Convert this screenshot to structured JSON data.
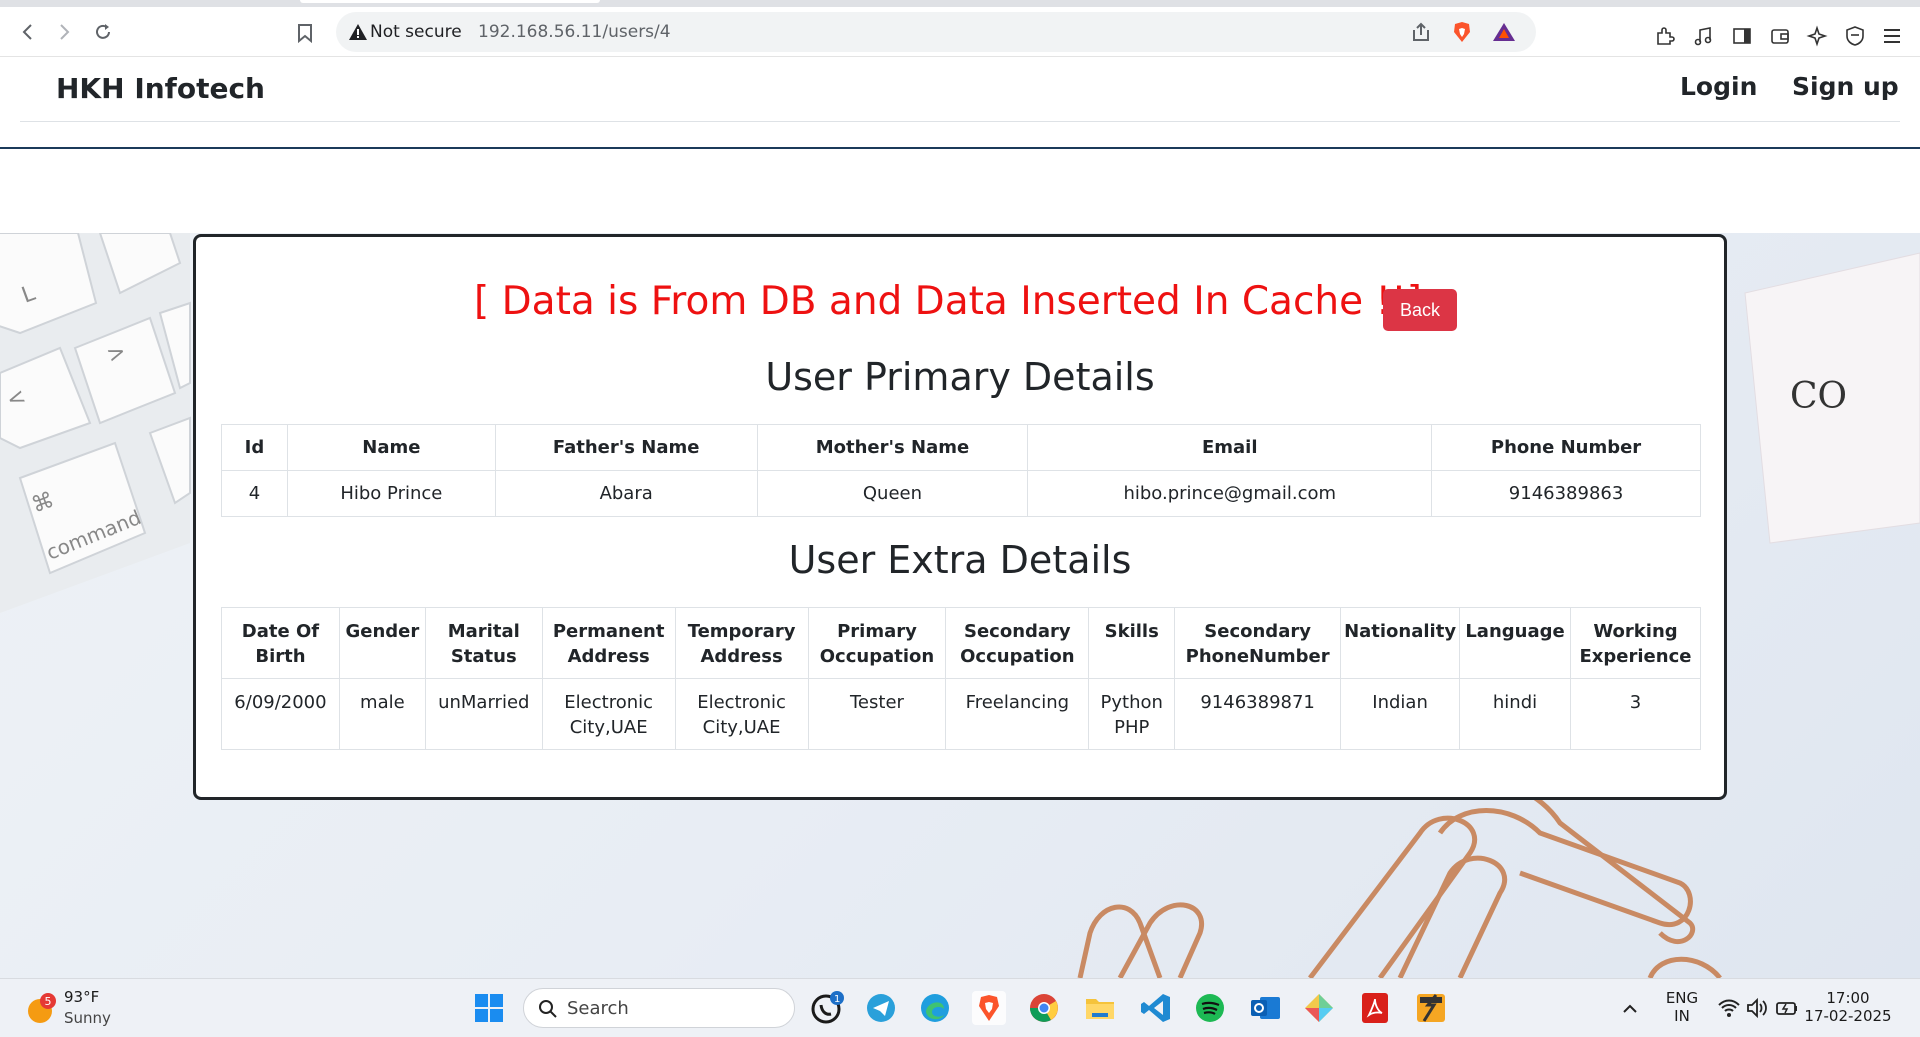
{
  "browser": {
    "security_label": "Not secure",
    "url": "192.168.56.11/users/4"
  },
  "site": {
    "brand": "HKH Infotech",
    "nav": {
      "login": "Login",
      "signup": "Sign up"
    }
  },
  "main": {
    "status_message": "[ Data is From DB and Data Inserted In Cache !!]",
    "back_label": "Back",
    "primary_title": "User Primary Details",
    "primary_headers": [
      "Id",
      "Name",
      "Father's Name",
      "Mother's Name",
      "Email",
      "Phone Number"
    ],
    "primary_row": [
      "4",
      "Hibo Prince",
      "Abara",
      "Queen",
      "hibo.prince@gmail.com",
      "9146389863"
    ],
    "extra_title": "User Extra Details",
    "extra_headers": [
      "Date Of Birth",
      "Gender",
      "Marital Status",
      "Permanent Address",
      "Temporary Address",
      "Primary Occupation",
      "Secondary Occupation",
      "Skills",
      "Secondary PhoneNumber",
      "Nationality",
      "Language",
      "Working Experience"
    ],
    "extra_row": [
      "6/09/2000",
      "male",
      "unMarried",
      "Electronic City,UAE",
      "Electronic City,UAE",
      "Tester",
      "Freelancing",
      "Python PHP",
      "9146389871",
      "Indian",
      "hindi",
      "3"
    ]
  },
  "background": {
    "keyboard_key_label": "command",
    "notebook_text": "CO"
  },
  "taskbar": {
    "weather_temp": "93°F",
    "weather_desc": "Sunny",
    "weather_badge": "5",
    "search_label": "Search",
    "whatsapp_badge": "1",
    "lang_top": "ENG",
    "lang_bottom": "IN",
    "time": "17:00",
    "date": "17-02-2025"
  },
  "colors": {
    "status_red": "#ee1111",
    "back_button": "#dc3545",
    "card_border": "#212529",
    "header_rule": "#1b3a5a"
  }
}
